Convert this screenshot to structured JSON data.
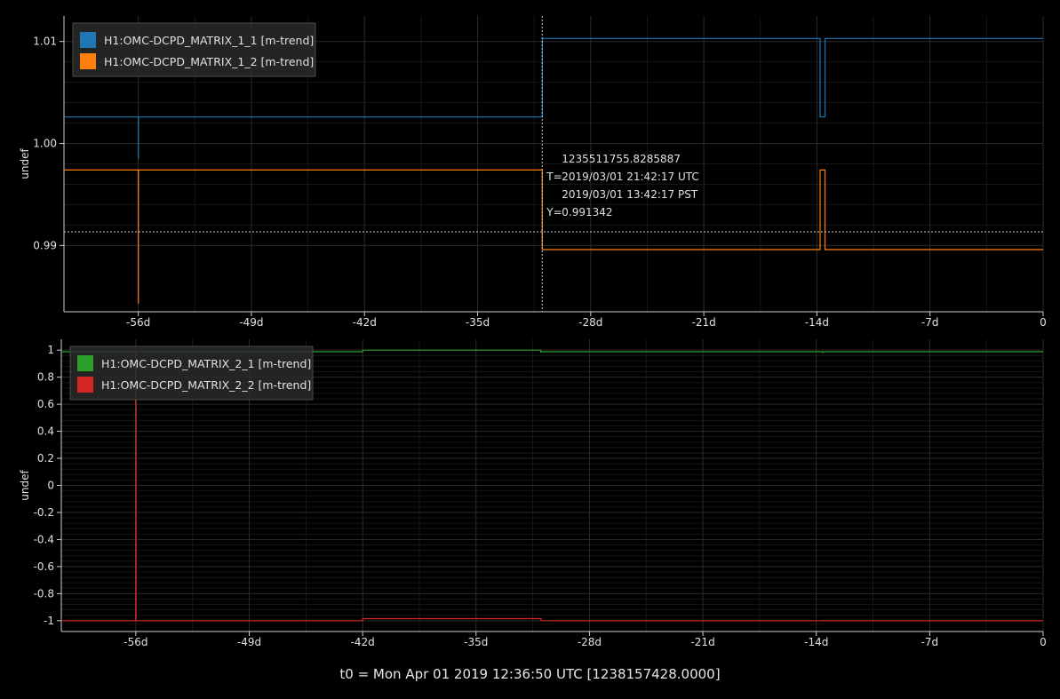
{
  "colors": {
    "background": "#000000",
    "grid_major": "#2b2b2b",
    "grid_minor": "#161616",
    "axis": "#cfcfcf",
    "text": "#e0e0e0",
    "legend_bg": "#2a2a2a",
    "legend_border": "#4a4a4a"
  },
  "footer_label": "t0 = Mon Apr 01 2019 12:36:50 UTC [1238157428.0000]",
  "chart_data": [
    {
      "type": "line",
      "ylabel": "undef",
      "xlim": [
        -60.6,
        0
      ],
      "ylim": [
        0.9835,
        1.0125
      ],
      "x_ticks": [
        -56,
        -49,
        -42,
        -35,
        -28,
        -21,
        -14,
        -7,
        0
      ],
      "x_tick_labels": [
        "-56d",
        "-49d",
        "-42d",
        "-35d",
        "-28d",
        "-21d",
        "-14d",
        "-7d",
        "0"
      ],
      "y_ticks": [
        0.99,
        1.0,
        1.01
      ],
      "y_tick_labels": [
        "0.99",
        "1.00",
        "1.01"
      ],
      "grid": true,
      "legend": "top-left",
      "series": [
        {
          "name": "H1:OMC-DCPD_MATRIX_1_1 [m-trend]",
          "color": "#1f77b4",
          "points": [
            [
              -60.6,
              1.0026
            ],
            [
              -56.0,
              1.0026
            ],
            [
              -56.0,
              0.9985
            ],
            [
              -55.99,
              1.0026
            ],
            [
              -31.0,
              1.0026
            ],
            [
              -31.0,
              1.0103
            ],
            [
              -13.8,
              1.0103
            ],
            [
              -13.8,
              1.0026
            ],
            [
              -13.5,
              1.0026
            ],
            [
              -13.5,
              1.0103
            ],
            [
              0,
              1.0103
            ]
          ]
        },
        {
          "name": "H1:OMC-DCPD_MATRIX_1_2 [m-trend]",
          "color": "#ff7f0e",
          "points": [
            [
              -60.6,
              0.9974
            ],
            [
              -56.0,
              0.9974
            ],
            [
              -56.0,
              0.9843
            ],
            [
              -55.99,
              0.9974
            ],
            [
              -31.0,
              0.9974
            ],
            [
              -31.0,
              0.9896
            ],
            [
              -13.8,
              0.9896
            ],
            [
              -13.8,
              0.9974
            ],
            [
              -13.5,
              0.9974
            ],
            [
              -13.5,
              0.9896
            ],
            [
              0,
              0.9896
            ]
          ]
        }
      ],
      "crosshair": {
        "x": -31.0,
        "y": 0.991342,
        "lines": [
          "1235511755.8285887",
          "2019/03/01 21:42:17 UTC",
          "2019/03/01 13:42:17 PST",
          "0.991342"
        ],
        "t_label": "T=",
        "y_label": "Y="
      }
    },
    {
      "type": "line",
      "ylabel": "undef",
      "xlim": [
        -60.6,
        0
      ],
      "ylim": [
        -1.08,
        1.08
      ],
      "x_ticks": [
        -56,
        -49,
        -42,
        -35,
        -28,
        -21,
        -14,
        -7,
        0
      ],
      "x_tick_labels": [
        "-56d",
        "-49d",
        "-42d",
        "-35d",
        "-28d",
        "-21d",
        "-14d",
        "-7d",
        "0"
      ],
      "y_ticks": [
        1,
        0.8,
        0.6,
        0.4,
        0.2,
        0,
        -0.2,
        -0.4,
        -0.6,
        -0.8,
        -1
      ],
      "y_tick_labels": [
        "1",
        "0.8",
        "0.6",
        "0.4",
        "0.2",
        "0",
        "-0.2",
        "-0.4",
        "-0.6",
        "-0.8",
        "-1"
      ],
      "grid": true,
      "legend": "top-left",
      "series": [
        {
          "name": "H1:OMC-DCPD_MATRIX_2_1 [m-trend]",
          "color": "#2ca02c",
          "points": [
            [
              -60.6,
              0.988
            ],
            [
              -56.0,
              0.988
            ],
            [
              -56.0,
              -1.0
            ],
            [
              -55.99,
              0.988
            ],
            [
              -42.0,
              0.988
            ],
            [
              -42.0,
              1.0
            ],
            [
              -31.0,
              1.0
            ],
            [
              -31.0,
              0.985
            ],
            [
              -30.9,
              0.988
            ],
            [
              -13.6,
              0.988
            ],
            [
              -13.6,
              0.982
            ],
            [
              -13.5,
              0.988
            ],
            [
              0,
              0.988
            ]
          ]
        },
        {
          "name": "H1:OMC-DCPD_MATRIX_2_2 [m-trend]",
          "color": "#d62728",
          "points": [
            [
              -60.6,
              -1.0
            ],
            [
              -56.0,
              -1.0
            ],
            [
              -56.0,
              0.99
            ],
            [
              -55.99,
              -1.0
            ],
            [
              -42.0,
              -1.0
            ],
            [
              -42.0,
              -0.985
            ],
            [
              -31.0,
              -0.985
            ],
            [
              -31.0,
              -0.995
            ],
            [
              -30.9,
              -1.0
            ],
            [
              -13.6,
              -1.0
            ],
            [
              -13.6,
              -0.997
            ],
            [
              -13.5,
              -1.0
            ],
            [
              0,
              -1.0
            ]
          ]
        }
      ]
    }
  ]
}
